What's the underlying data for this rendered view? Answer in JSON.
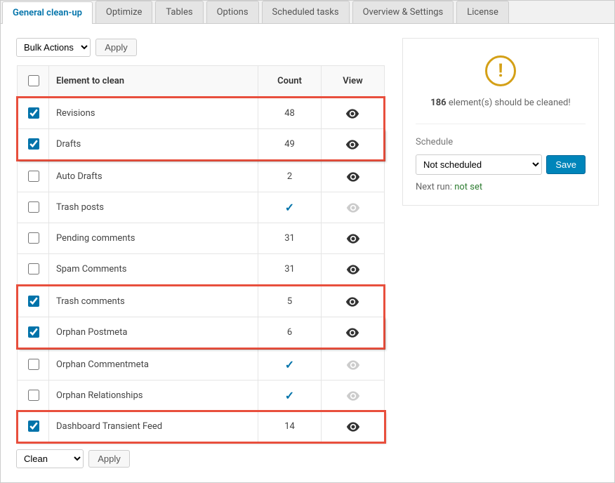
{
  "tabs": [
    {
      "label": "General clean-up",
      "active": true
    },
    {
      "label": "Optimize",
      "active": false
    },
    {
      "label": "Tables",
      "active": false
    },
    {
      "label": "Options",
      "active": false
    },
    {
      "label": "Scheduled tasks",
      "active": false
    },
    {
      "label": "Overview & Settings",
      "active": false
    },
    {
      "label": "License",
      "active": false
    }
  ],
  "bulk_actions": {
    "top_selected": "Bulk Actions",
    "apply": "Apply",
    "bottom_selected": "Clean"
  },
  "columns": {
    "element": "Element to clean",
    "count": "Count",
    "view": "View"
  },
  "rows": [
    {
      "label": "Revisions",
      "count": "48",
      "checked": true,
      "eye": "dark",
      "highlight": "top"
    },
    {
      "label": "Drafts",
      "count": "49",
      "checked": true,
      "eye": "dark",
      "highlight": "bottom"
    },
    {
      "label": "Auto Drafts",
      "count": "2",
      "checked": false,
      "eye": "dark",
      "highlight": ""
    },
    {
      "label": "Trash posts",
      "count": "check",
      "checked": false,
      "eye": "light",
      "highlight": ""
    },
    {
      "label": "Pending comments",
      "count": "31",
      "checked": false,
      "eye": "dark",
      "highlight": ""
    },
    {
      "label": "Spam Comments",
      "count": "31",
      "checked": false,
      "eye": "dark",
      "highlight": ""
    },
    {
      "label": "Trash comments",
      "count": "5",
      "checked": true,
      "eye": "dark",
      "highlight": "top"
    },
    {
      "label": "Orphan Postmeta",
      "count": "6",
      "checked": true,
      "eye": "dark",
      "highlight": "bottom"
    },
    {
      "label": "Orphan Commentmeta",
      "count": "check",
      "checked": false,
      "eye": "light",
      "highlight": ""
    },
    {
      "label": "Orphan Relationships",
      "count": "check",
      "checked": false,
      "eye": "light",
      "highlight": ""
    },
    {
      "label": "Dashboard Transient Feed",
      "count": "14",
      "checked": true,
      "eye": "dark",
      "highlight": "single"
    }
  ],
  "summary": {
    "count": "186",
    "text": " element(s) should be cleaned!"
  },
  "schedule": {
    "title": "Schedule",
    "selected": "Not scheduled",
    "save": "Save",
    "nextrun_label": "Next run: ",
    "nextrun_value": "not set"
  }
}
